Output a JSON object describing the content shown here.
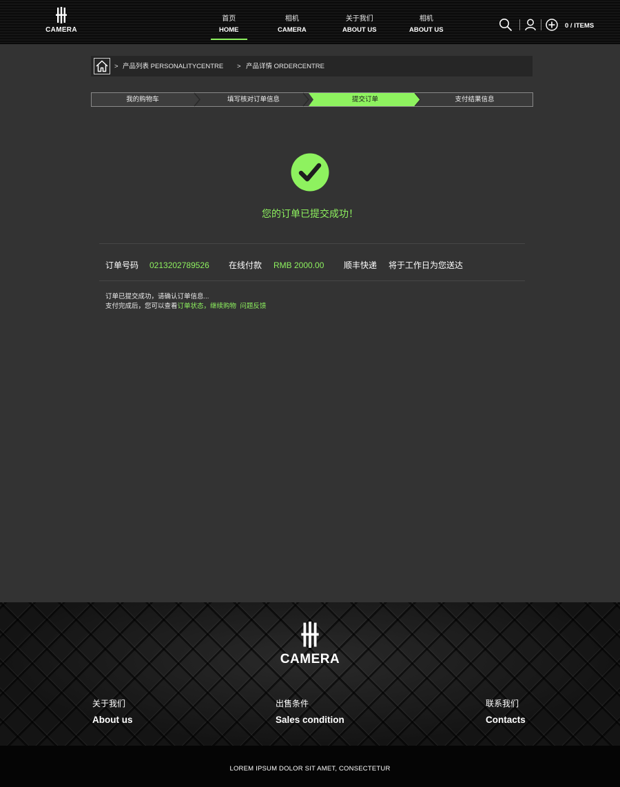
{
  "brand": {
    "name": "CAMERA"
  },
  "header": {
    "nav": [
      {
        "cn": "首页",
        "en": "HOME",
        "active": true
      },
      {
        "cn": "相机",
        "en": "CAMERA",
        "active": false
      },
      {
        "cn": "关于我们",
        "en": "ABOUT US",
        "active": false
      },
      {
        "cn": "相机",
        "en": "ABOUT US",
        "active": false
      }
    ],
    "icons": [
      "search-icon",
      "user-icon",
      "add-circle-icon"
    ],
    "cart_label": "0 / ITEMS"
  },
  "breadcrumb": {
    "sep": ">",
    "items": [
      "产品列表  PERSONALITYCENTRE",
      "产品详情  ORDERCENTRE"
    ]
  },
  "steps": [
    {
      "label": "我的购物车",
      "active": false
    },
    {
      "label": "填写核对订单信息",
      "active": false
    },
    {
      "label": "提交订单",
      "active": true
    },
    {
      "label": "支付结果信息",
      "active": false
    }
  ],
  "success": {
    "message": "您的订单已提交成功！"
  },
  "order": {
    "number_label": "订单号码",
    "number": "0213202789526",
    "payment_method": "在线付款",
    "amount": "RMB  2000.00",
    "shipping": "顺丰快递",
    "delivery_note": "将于工作日为您送达"
  },
  "notes": {
    "line1": "订单已提交成功，请确认订单信息...",
    "line2_prefix": "支付完成后，您可以查看",
    "link_status": "订单状态，",
    "link_continue": "继续购物",
    "link_feedback": "问题反馈"
  },
  "footer": {
    "links": [
      {
        "cn": "关于我们",
        "en": "About us"
      },
      {
        "cn": "出售条件",
        "en": "Sales condition"
      },
      {
        "cn": "联系我们",
        "en": "Contacts"
      }
    ],
    "copyright": "LOREM IPSUM DOLOR SIT AMET, CONSECTETUR"
  },
  "colors": {
    "accent": "#8ef25f",
    "background": "#333333",
    "header": "#111111"
  }
}
